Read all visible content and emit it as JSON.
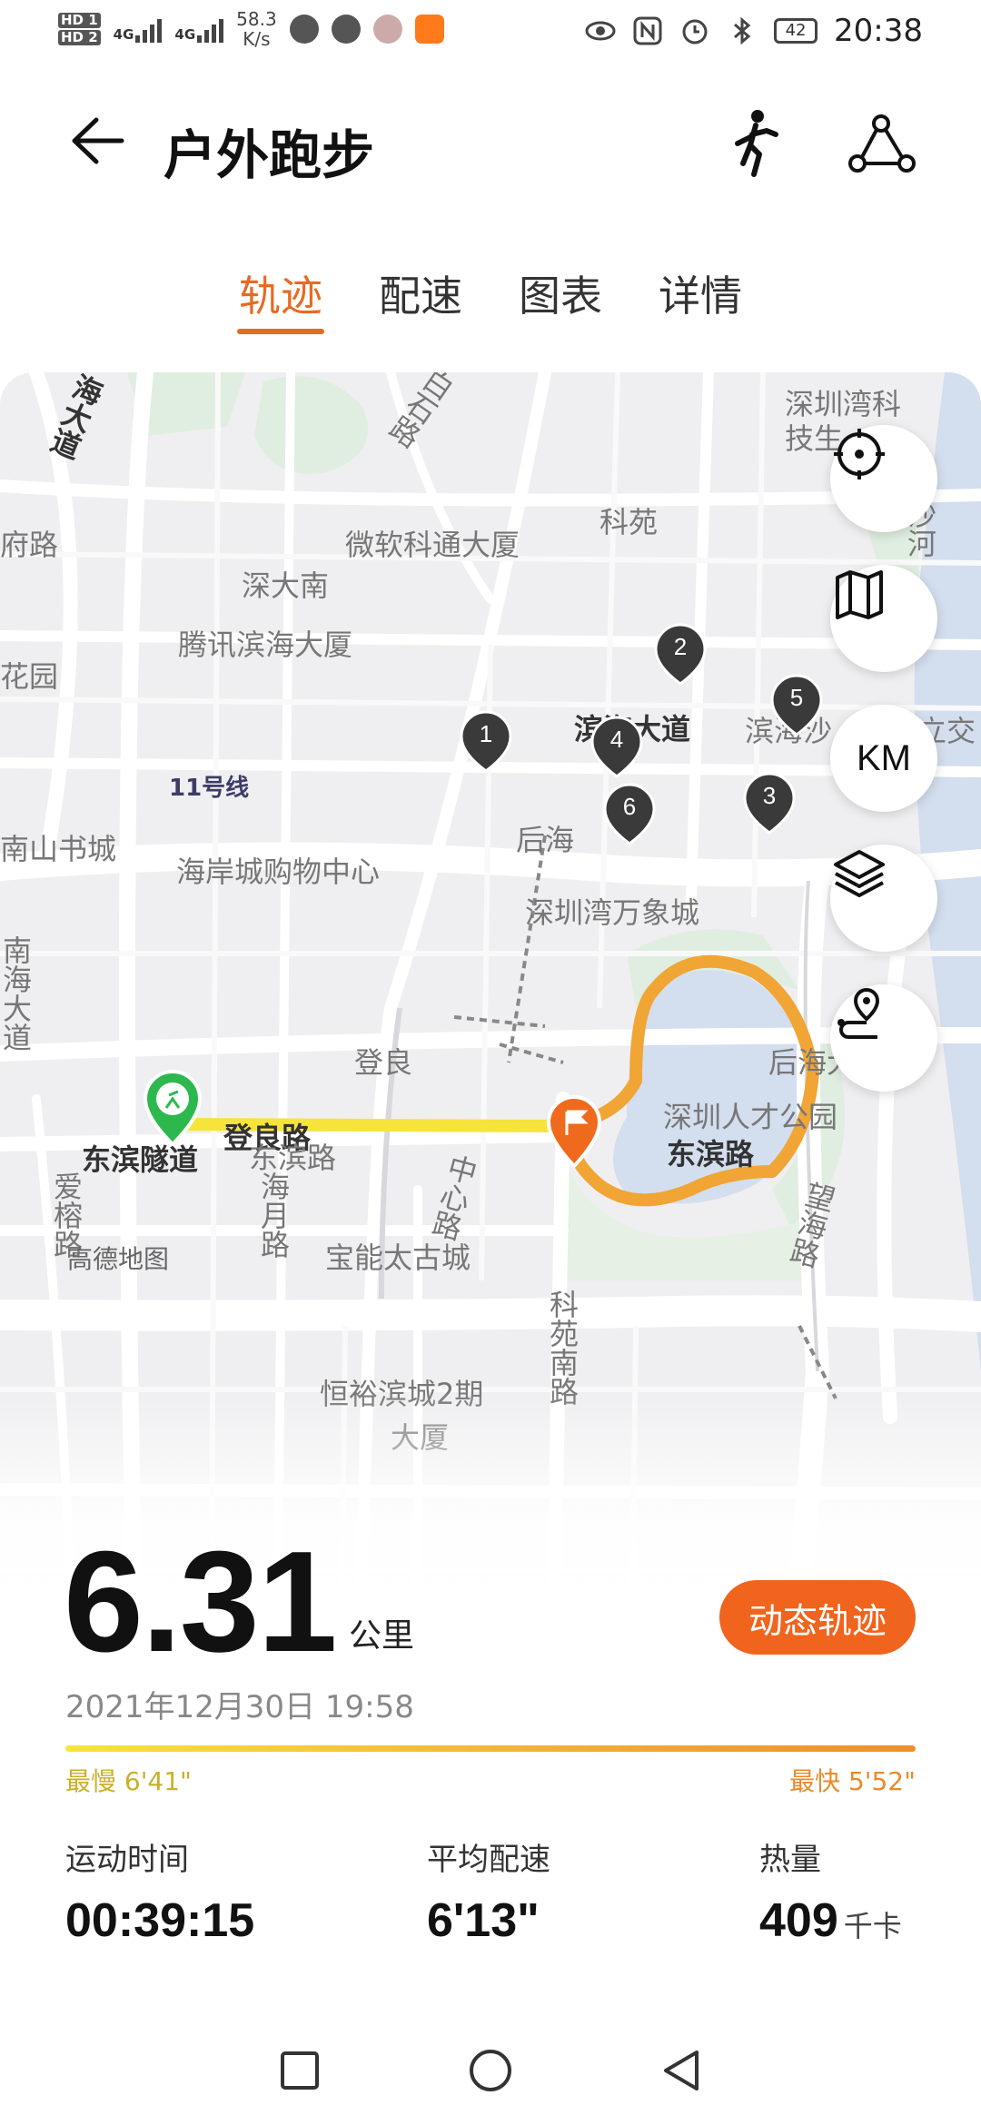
{
  "status_bar": {
    "sim1": "HD 1",
    "sim2": "HD 2",
    "net1": "4G",
    "net2": "4G",
    "net_speed_value": "58.3",
    "net_speed_unit": "K/s",
    "battery": "42",
    "time": "20:38",
    "icons": [
      "wechat-icon",
      "browser-icon",
      "avatar-app-icon",
      "video-app-icon",
      "eye-icon",
      "nfc-icon",
      "alarm-icon",
      "bluetooth-icon",
      "battery-icon"
    ]
  },
  "header": {
    "title": "户外跑步",
    "back_icon": "arrow-left-icon",
    "runner_icon": "runner-icon",
    "route_icon": "route-share-icon"
  },
  "tabs": [
    {
      "label": "轨迹",
      "active": true
    },
    {
      "label": "配速",
      "active": false
    },
    {
      "label": "图表",
      "active": false
    },
    {
      "label": "详情",
      "active": false
    }
  ],
  "map": {
    "labels": {
      "haidadao": "海大道",
      "baishi": "白石路",
      "shenzhenwan": "深圳湾科",
      "jisheng": "技生",
      "fulu": "府路",
      "weiruan": "微软科通大厦",
      "keyuan": "科苑",
      "shenda": "深大南",
      "shahe": "沙河",
      "tengxun": "腾讯滨海大厦",
      "binhai": "滨海大道",
      "binhai2": "滨海沙",
      "li": "立交",
      "huayuan": "花园",
      "metro": "11号线",
      "nanshan": "南山书城",
      "houhai": "后海",
      "haian": "海岸城购物中心",
      "wanxiang": "深圳湾万象城",
      "nanhai": "南海大道",
      "dengliang": "登良路",
      "dengliang2": "登良",
      "houhaidaqiao": "后海大桥",
      "rencai": "深圳人才公园",
      "dongbinsuidao": "东滨隧道",
      "dongbin1": "东滨路",
      "dongbin2": "东滨路",
      "airong": "爱榕路",
      "haiyue": "海月路",
      "zhongxin": "中心路",
      "wanghai": "望海路",
      "baoneng": "宝能太古城",
      "keyuannan": "科苑南路",
      "hengyu": "恒裕滨城2期",
      "dasha": "大厦"
    },
    "attribution": "高德地图",
    "controls": [
      "locate-icon",
      "map-icon",
      "KM",
      "layers-icon",
      "route-pin-icon"
    ],
    "km_markers": [
      "1",
      "2",
      "3",
      "4",
      "5",
      "6"
    ],
    "start_icon": "runner-start-icon",
    "end_icon": "flag-icon"
  },
  "summary": {
    "distance": "6.31",
    "distance_unit": "公里",
    "dynamic_button": "动态轨迹",
    "date": "2021年12月30日 19:58",
    "slowest": "最慢 6'41\"",
    "fastest": "最快 5'52\"",
    "stats": [
      {
        "label": "运动时间",
        "value": "00:39:15",
        "unit": ""
      },
      {
        "label": "平均配速",
        "value": "6'13\"",
        "unit": ""
      },
      {
        "label": "热量",
        "value": "409",
        "unit": "千卡"
      }
    ]
  },
  "navbar": {
    "icons": [
      "recent-apps-icon",
      "home-icon",
      "back-icon"
    ]
  },
  "colors": {
    "accent": "#e86a22",
    "button": "#f0641e",
    "track_yellow": "#f6e43a",
    "track_orange": "#f0a535",
    "water": "#d3deee",
    "park": "#dfeee0"
  }
}
